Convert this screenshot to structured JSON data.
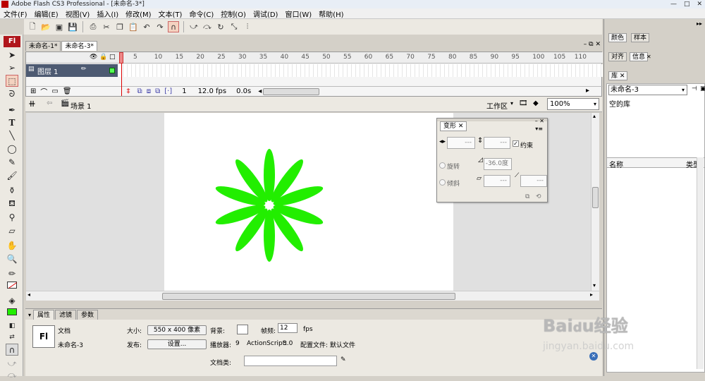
{
  "window": {
    "title": "Adobe Flash CS3 Professional - [未命名-3*]"
  },
  "menu": [
    "文件(F)",
    "编辑(E)",
    "视图(V)",
    "插入(I)",
    "修改(M)",
    "文本(T)",
    "命令(C)",
    "控制(O)",
    "调试(D)",
    "窗口(W)",
    "帮助(H)"
  ],
  "tools_logo": "Fl",
  "doc_tabs": [
    "未命名-1*",
    "未命名-3*"
  ],
  "timeline": {
    "ruler": [
      "5",
      "10",
      "15",
      "20",
      "25",
      "30",
      "35",
      "40",
      "45",
      "50",
      "55",
      "60",
      "65",
      "70",
      "75",
      "80",
      "85",
      "90",
      "95",
      "100",
      "105",
      "110"
    ],
    "layer_name": "图层 1",
    "current_frame": "1",
    "fps": "12.0 fps",
    "time": "0.0s"
  },
  "editbar": {
    "scene": "场景 1",
    "workspace": "工作区",
    "zoom": "100%"
  },
  "transform_panel": {
    "tab": "变形",
    "width_value": "---",
    "height_value": "---",
    "constrain_label": "约束",
    "rotate_label": "旋转",
    "rotate_value": "-36.0度",
    "skew_label": "倾斜",
    "skew_h_value": "---",
    "skew_v_value": "---"
  },
  "properties": {
    "tabs": [
      "属性",
      "滤镜",
      "参数"
    ],
    "doc_type": "文档",
    "doc_name": "未命名-3",
    "size_label": "大小:",
    "size_value": "550 x 400 像素",
    "bg_label": "背景:",
    "fps_label": "帧频:",
    "fps_value": "12",
    "fps_unit": "fps",
    "publish_label": "发布:",
    "settings_button": "设置...",
    "player_label": "播放器:",
    "player_value": "9",
    "as_label": "ActionScript:",
    "as_value": "3.0",
    "profile_label": "配置文件:",
    "profile_value": "默认文件",
    "docclass_label": "文档类:"
  },
  "right_panels": {
    "tabs_row1": [
      "颜色",
      "样本"
    ],
    "tabs_row2": [
      "对齐",
      "信息"
    ],
    "library_tab": "库",
    "library_select": "未命名-3",
    "library_empty": "空的库",
    "col_name": "名称",
    "col_type": "类型"
  },
  "watermark": "Baidu经验 jingyan.baidu.com",
  "colors": {
    "flower": "#22ee00",
    "stroke_swatch": "#222222",
    "fill_swatch": "#22ee00"
  }
}
